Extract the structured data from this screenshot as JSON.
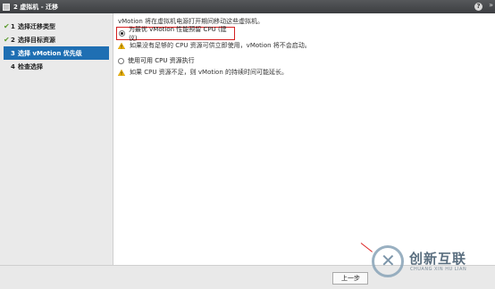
{
  "window": {
    "title": "2 虚拟机 - 迁移",
    "help_label": "?",
    "expand_label": "»"
  },
  "steps": [
    {
      "num": "1",
      "label": "选择迁移类型",
      "done": true
    },
    {
      "num": "2",
      "label": "选择目标资源",
      "done": true
    },
    {
      "num": "3",
      "label": "选择 vMotion 优先级",
      "done": false,
      "active": true
    },
    {
      "num": "4",
      "label": "检查选择",
      "done": false
    }
  ],
  "content": {
    "intro": "vMotion 将在虚拟机电源打开期间移动这些虚拟机。",
    "option1": {
      "label": "为最优 vMotion 性能预留 CPU (建议)",
      "selected": true
    },
    "warning1": "如果没有足够的 CPU 资源可供立即使用，vMotion 将不会启动。",
    "option2": {
      "label": "使用可用 CPU 资源执行",
      "selected": false
    },
    "warning2": "如果 CPU 资源不足，则 vMotion 的持续时间可能延长。"
  },
  "footer": {
    "back_label": "上一步"
  },
  "watermark": {
    "text": "创新互联",
    "sub": "CHUANG XIN HU LIAN"
  },
  "colors": {
    "active_step": "#1f6fb3",
    "highlight_border": "#d42020",
    "check": "#5a9a2c",
    "warning": "#f0b400"
  }
}
